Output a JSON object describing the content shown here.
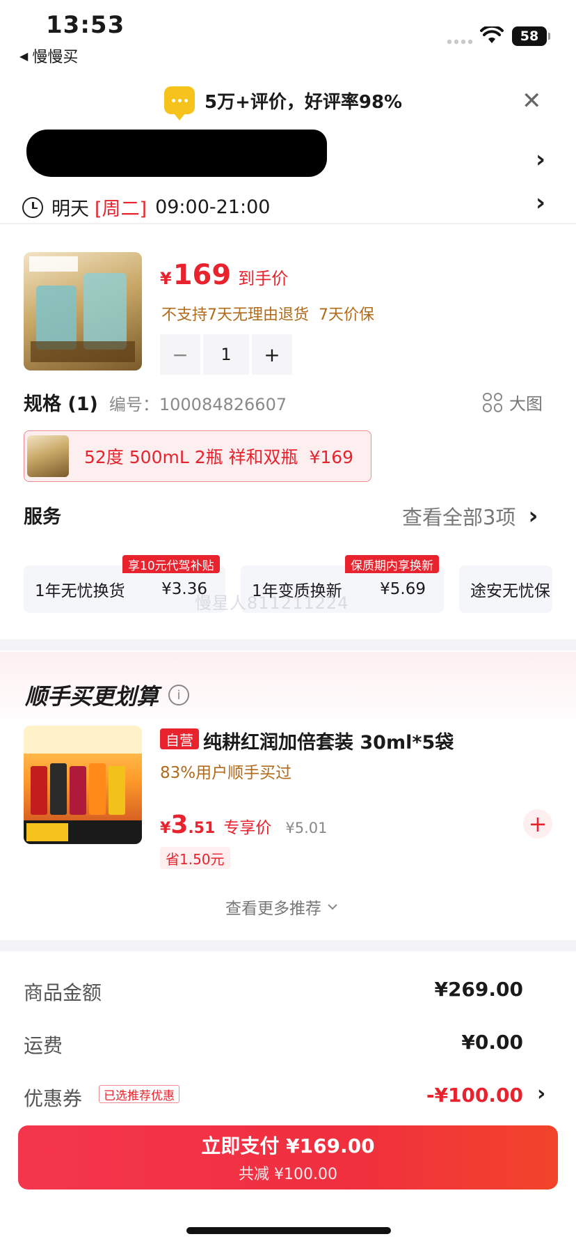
{
  "status_bar": {
    "time": "13:53",
    "back_app": "慢慢买",
    "battery": "58"
  },
  "review_banner": {
    "text": "5万+评价，好评率98%"
  },
  "delivery": {
    "day": "明天",
    "weekday": "[周二]",
    "window": "09:00-21:00"
  },
  "product": {
    "price_symbol": "¥",
    "price": "169",
    "price_label": "到手价",
    "policy": "不支持7天无理由退货  7天价保",
    "quantity": "1",
    "minus": "−",
    "plus": "+"
  },
  "spec": {
    "title": "规格 (1)",
    "code": "编号：100084826607",
    "big_image": "大图",
    "selected": "52度 500mL 2瓶 祥和双瓶  ¥169"
  },
  "service": {
    "title": "服务",
    "view_all": "查看全部3项",
    "cards": [
      {
        "name": "1年无忧换货",
        "price": "¥3.36",
        "tag": "享10元代驾补贴"
      },
      {
        "name": "1年变质换新",
        "price": "¥5.69",
        "tag": "保质期内享换新"
      },
      {
        "name": "途安无忧保",
        "price": "",
        "tag": ""
      }
    ],
    "watermark": "慢星人811211224"
  },
  "recommend": {
    "title": "顺手买更划算",
    "info": "i",
    "self_operated": "自营",
    "name": "纯耕红润加倍套装 30ml*5袋",
    "bought": "83%用户顺手买过",
    "price_symbol": "¥",
    "price_int": "3",
    "price_dec": ".51",
    "price_label": "专享价",
    "old_price": "¥5.01",
    "save": "省1.50元",
    "add": "+",
    "more": "查看更多推荐"
  },
  "totals": {
    "goods_label": "商品金额",
    "goods_value": "¥269.00",
    "shipping_label": "运费",
    "shipping_value": "¥0.00",
    "coupon_label": "优惠券",
    "coupon_tag": "已选推荐优惠",
    "coupon_value": "-¥100.00"
  },
  "pay": {
    "main": "立即支付 ¥169.00",
    "sub": "共减 ¥100.00"
  },
  "colors": {
    "accent": "#e8232d",
    "gold": "#b06a1a"
  }
}
